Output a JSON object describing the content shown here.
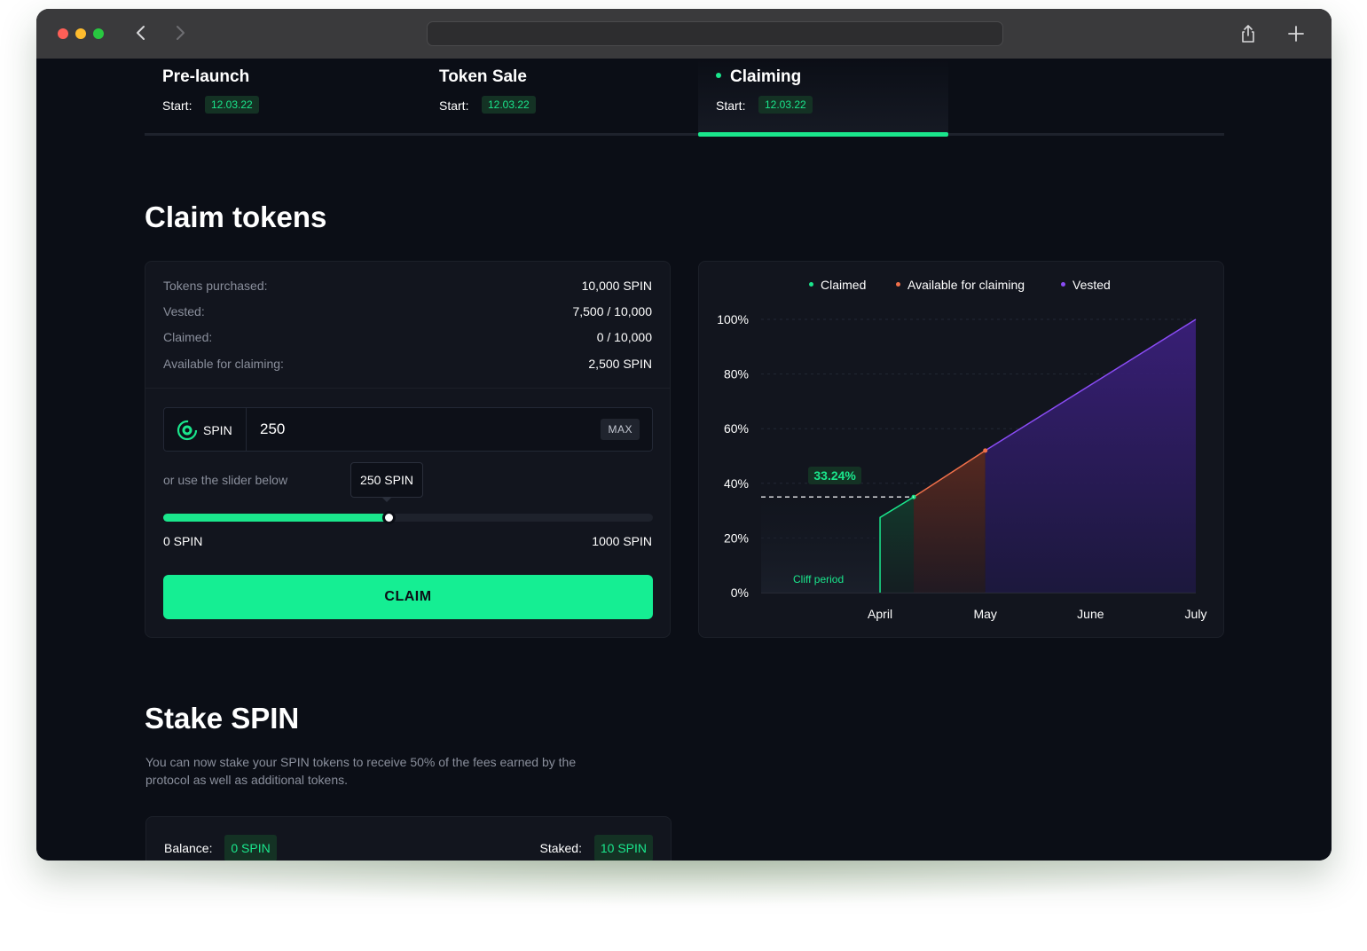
{
  "phases": [
    {
      "title": "Pre-launch",
      "start_label": "Start:",
      "date": "12.03.22",
      "active": false
    },
    {
      "title": "Token Sale",
      "start_label": "Start:",
      "date": "12.03.22",
      "active": false
    },
    {
      "title": "Claiming",
      "start_label": "Start:",
      "date": "12.03.22",
      "active": true
    }
  ],
  "claim": {
    "heading": "Claim tokens",
    "rows": [
      {
        "label": "Tokens purchased:",
        "value": "10,000 SPIN"
      },
      {
        "label": "Vested:",
        "value": "7,500 / 10,000"
      },
      {
        "label": "Claimed:",
        "value": "0 / 10,000"
      },
      {
        "label": "Available for claiming:",
        "value": "2,500 SPIN"
      }
    ],
    "token_label": "SPIN",
    "amount_value": "250",
    "max_label": "MAX",
    "slider_hint": "or use the slider below",
    "tooltip": "250 SPIN",
    "slider_min_label": "0 SPIN",
    "slider_max_label": "1000 SPIN",
    "slider_value_fraction": 0.46,
    "button_label": "CLAIM"
  },
  "chart_data": {
    "type": "area",
    "legend": [
      {
        "name": "Claimed",
        "color": "#1ae68c"
      },
      {
        "name": "Available for claiming",
        "color": "#f0704a"
      },
      {
        "name": "Vested",
        "color": "#8a4cf5"
      }
    ],
    "y_ticks": [
      "100%",
      "80%",
      "60%",
      "40%",
      "20%",
      "0%"
    ],
    "x_ticks": [
      "April",
      "May",
      "June",
      "July"
    ],
    "ylim": [
      0,
      100
    ],
    "marker_label": "33.24%",
    "marker_value": 33.24,
    "cliff_label": "Cliff period",
    "series": [
      {
        "name": "Claimed",
        "points": [
          [
            0,
            27.5
          ],
          [
            0.32,
            35
          ]
        ]
      },
      {
        "name": "Available for claiming",
        "points": [
          [
            0.32,
            35
          ],
          [
            1.0,
            52
          ]
        ]
      },
      {
        "name": "Vested",
        "points": [
          [
            1.0,
            52
          ],
          [
            3.0,
            100
          ]
        ]
      }
    ],
    "grid": true,
    "legend_position": "top-center"
  },
  "stake": {
    "heading": "Stake SPIN",
    "description": "You can now stake your SPIN tokens to receive 50% of the fees earned by the protocol as well as additional tokens.",
    "balance_label": "Balance:",
    "balance_value": "0 SPIN",
    "staked_label": "Staked:",
    "staked_value": "10 SPIN"
  },
  "colors": {
    "accent": "#1ae68c",
    "background": "#0b0e16",
    "card": "#12151e"
  }
}
